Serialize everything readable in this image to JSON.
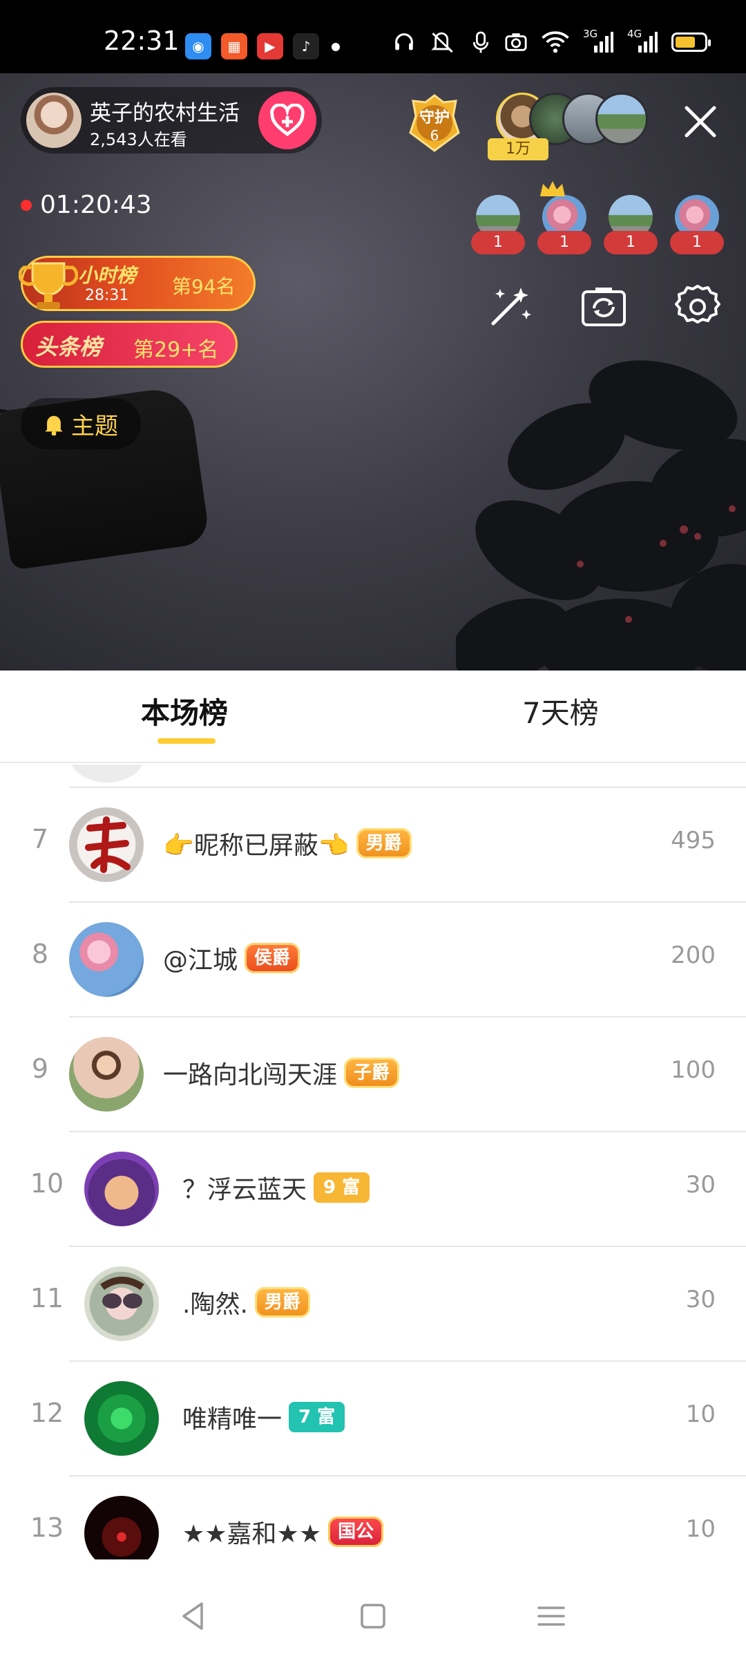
{
  "status_bar": {
    "time": "22:31",
    "network_3g": "3G",
    "network_4g": "4G"
  },
  "host": {
    "name": "英子的农村生活",
    "viewers": "2,543人在看"
  },
  "guard": {
    "label": "守护",
    "count": "6"
  },
  "top_contributors": {
    "coin_label": "1万"
  },
  "live": {
    "timer": "01:20:43"
  },
  "gift_counts": [
    "1",
    "1",
    "1",
    "1"
  ],
  "hour_rank": {
    "title": "小时榜",
    "countdown": "28:31",
    "rank": "第94名"
  },
  "headline_rank": {
    "title": "头条榜",
    "rank": "第29+名"
  },
  "topic_button": "主题",
  "tabs": {
    "current": "本场榜",
    "seven_day": "7天榜"
  },
  "leaderboard": [
    {
      "rank": "7",
      "name": "👉昵称已屏蔽👈",
      "badge": "男爵",
      "badge_type": "noble",
      "score": "495"
    },
    {
      "rank": "8",
      "name": "@江城",
      "badge": "侯爵",
      "badge_type": "hou",
      "score": "200"
    },
    {
      "rank": "9",
      "name": "一路向北闯天涯",
      "badge": "子爵",
      "badge_type": "zi",
      "score": "100"
    },
    {
      "rank": "10",
      "name": "？浮云蓝天",
      "badge": "9 富",
      "badge_type": "rich9",
      "score": "30"
    },
    {
      "rank": "11",
      "name": ".陶然.",
      "badge": "男爵",
      "badge_type": "noble",
      "score": "30"
    },
    {
      "rank": "12",
      "name": "唯精唯一",
      "badge": "7 富",
      "badge_type": "rich7",
      "score": "10"
    },
    {
      "rank": "13",
      "name": "★★嘉和★★",
      "badge": "国公",
      "badge_type": "guo",
      "score": "10"
    }
  ],
  "colors": {
    "accent_yellow": "#ffcc33",
    "follow_pink": "#ff3d6e",
    "live_red": "#ff2d2d"
  }
}
